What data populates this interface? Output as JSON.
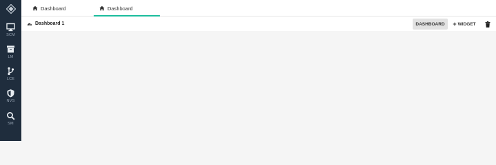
{
  "sidebar": {
    "items": [
      {
        "label": "SCM",
        "icon": "monitor-icon"
      },
      {
        "label": "LM",
        "icon": "archive-icon"
      },
      {
        "label": "LCE",
        "icon": "branch-icon"
      },
      {
        "label": "NVS",
        "icon": "shield-icon"
      },
      {
        "label": "SM",
        "icon": "search-icon"
      }
    ]
  },
  "tabs": [
    {
      "label": "Dashboard",
      "icon": "home-icon",
      "active": false
    },
    {
      "label": "Dashboard",
      "icon": "home-icon",
      "active": true
    }
  ],
  "toolbar": {
    "title": "Dashboard 1",
    "dashboard_label": "DASHBOARD",
    "widget_label": "WIDGET"
  },
  "colors": {
    "sidebar_bg": "#1f2d3d",
    "accent": "#1abc9c"
  }
}
